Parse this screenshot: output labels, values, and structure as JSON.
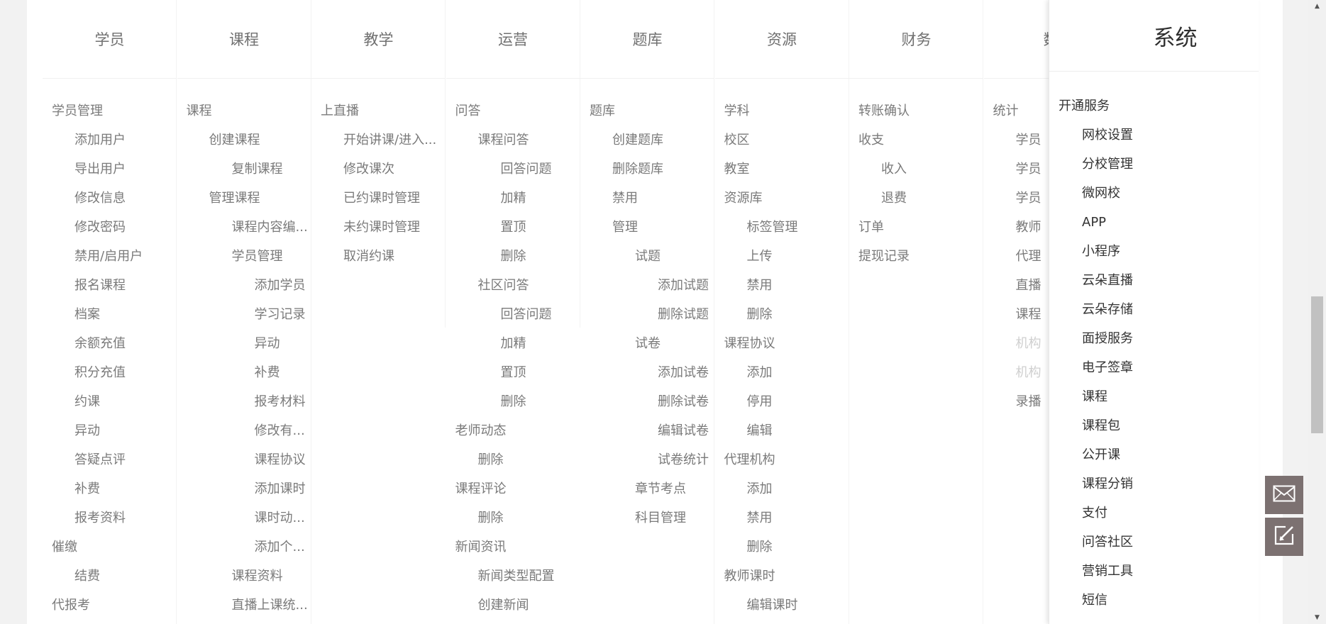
{
  "columns": [
    {
      "title": "学员",
      "items": [
        {
          "text": "学员管理",
          "level": 0,
          "faded": false
        },
        {
          "text": "添加用户",
          "level": 1,
          "faded": false
        },
        {
          "text": "导出用户",
          "level": 1,
          "faded": false
        },
        {
          "text": "修改信息",
          "level": 1,
          "faded": false
        },
        {
          "text": "修改密码",
          "level": 1,
          "faded": false
        },
        {
          "text": "禁用/启用户",
          "level": 1,
          "faded": false
        },
        {
          "text": "报名课程",
          "level": 1,
          "faded": false
        },
        {
          "text": "档案",
          "level": 1,
          "faded": false
        },
        {
          "text": "余额充值",
          "level": 1,
          "faded": false
        },
        {
          "text": "积分充值",
          "level": 1,
          "faded": false
        },
        {
          "text": "约课",
          "level": 1,
          "faded": false
        },
        {
          "text": "异动",
          "level": 1,
          "faded": false
        },
        {
          "text": "答疑点评",
          "level": 1,
          "faded": false
        },
        {
          "text": "补费",
          "level": 1,
          "faded": false
        },
        {
          "text": "报考资料",
          "level": 1,
          "faded": false
        },
        {
          "text": "催缴",
          "level": 0,
          "faded": false
        },
        {
          "text": "结费",
          "level": 1,
          "faded": false
        },
        {
          "text": "代报考",
          "level": 0,
          "faded": false
        }
      ]
    },
    {
      "title": "课程",
      "items": [
        {
          "text": "课程",
          "level": 0,
          "faded": false
        },
        {
          "text": "创建课程",
          "level": 1,
          "faded": false
        },
        {
          "text": "复制课程",
          "level": 2,
          "faded": false
        },
        {
          "text": "管理课程",
          "level": 1,
          "faded": false
        },
        {
          "text": "课程内容编...",
          "level": 2,
          "faded": false
        },
        {
          "text": "学员管理",
          "level": 2,
          "faded": false
        },
        {
          "text": "添加学员",
          "level": 3,
          "faded": false
        },
        {
          "text": "学习记录",
          "level": 3,
          "faded": false
        },
        {
          "text": "异动",
          "level": 3,
          "faded": false
        },
        {
          "text": "补费",
          "level": 3,
          "faded": false
        },
        {
          "text": "报考材料",
          "level": 3,
          "faded": false
        },
        {
          "text": "修改有...",
          "level": 3,
          "faded": false
        },
        {
          "text": "课程协议",
          "level": 3,
          "faded": false
        },
        {
          "text": "添加课时",
          "level": 3,
          "faded": false
        },
        {
          "text": "课时动...",
          "level": 3,
          "faded": false
        },
        {
          "text": "添加个...",
          "level": 3,
          "faded": false
        },
        {
          "text": "课程资料",
          "level": 2,
          "faded": false
        },
        {
          "text": "直播上课统...",
          "level": 2,
          "faded": false
        }
      ]
    },
    {
      "title": "教学",
      "items": [
        {
          "text": "上直播",
          "level": 0,
          "faded": false
        },
        {
          "text": "开始讲课/进入...",
          "level": 1,
          "faded": false
        },
        {
          "text": "修改课次",
          "level": 1,
          "faded": false
        },
        {
          "text": "已约课时管理",
          "level": 1,
          "faded": false
        },
        {
          "text": "未约课时管理",
          "level": 1,
          "faded": false
        },
        {
          "text": "取消约课",
          "level": 1,
          "faded": false
        }
      ]
    },
    {
      "title": "运营",
      "items": [
        {
          "text": "问答",
          "level": 0,
          "faded": false
        },
        {
          "text": "课程问答",
          "level": 1,
          "faded": false
        },
        {
          "text": "回答问题",
          "level": 2,
          "faded": false
        },
        {
          "text": "加精",
          "level": 2,
          "faded": false
        },
        {
          "text": "置顶",
          "level": 2,
          "faded": false
        },
        {
          "text": "删除",
          "level": 2,
          "faded": false
        },
        {
          "text": "社区问答",
          "level": 1,
          "faded": false
        },
        {
          "text": "回答问题",
          "level": 2,
          "faded": false
        },
        {
          "text": "加精",
          "level": 2,
          "faded": false
        },
        {
          "text": "置顶",
          "level": 2,
          "faded": false
        },
        {
          "text": "删除",
          "level": 2,
          "faded": false
        },
        {
          "text": "老师动态",
          "level": 0,
          "faded": false
        },
        {
          "text": "删除",
          "level": 1,
          "faded": false
        },
        {
          "text": "课程评论",
          "level": 0,
          "faded": false
        },
        {
          "text": "删除",
          "level": 1,
          "faded": false
        },
        {
          "text": "新闻资讯",
          "level": 0,
          "faded": false
        },
        {
          "text": "新闻类型配置",
          "level": 1,
          "faded": false
        },
        {
          "text": "创建新闻",
          "level": 1,
          "faded": false
        }
      ]
    },
    {
      "title": "题库",
      "items": [
        {
          "text": "题库",
          "level": 0,
          "faded": false
        },
        {
          "text": "创建题库",
          "level": 1,
          "faded": false
        },
        {
          "text": "删除题库",
          "level": 1,
          "faded": false
        },
        {
          "text": "禁用",
          "level": 1,
          "faded": false
        },
        {
          "text": "管理",
          "level": 1,
          "faded": false
        },
        {
          "text": "试题",
          "level": 2,
          "faded": false
        },
        {
          "text": "添加试题",
          "level": 3,
          "faded": false
        },
        {
          "text": "删除试题",
          "level": 3,
          "faded": false
        },
        {
          "text": "试卷",
          "level": 2,
          "faded": false
        },
        {
          "text": "添加试卷",
          "level": 3,
          "faded": false
        },
        {
          "text": "删除试卷",
          "level": 3,
          "faded": false
        },
        {
          "text": "编辑试卷",
          "level": 3,
          "faded": false
        },
        {
          "text": "试卷统计",
          "level": 3,
          "faded": false
        },
        {
          "text": "章节考点",
          "level": 2,
          "faded": false
        },
        {
          "text": "科目管理",
          "level": 2,
          "faded": false
        }
      ]
    },
    {
      "title": "资源",
      "items": [
        {
          "text": "学科",
          "level": 0,
          "faded": false
        },
        {
          "text": "校区",
          "level": 0,
          "faded": false
        },
        {
          "text": "教室",
          "level": 0,
          "faded": false
        },
        {
          "text": "资源库",
          "level": 0,
          "faded": false
        },
        {
          "text": "标签管理",
          "level": 1,
          "faded": false
        },
        {
          "text": "上传",
          "level": 1,
          "faded": false
        },
        {
          "text": "禁用",
          "level": 1,
          "faded": false
        },
        {
          "text": "删除",
          "level": 1,
          "faded": false
        },
        {
          "text": "课程协议",
          "level": 0,
          "faded": false
        },
        {
          "text": "添加",
          "level": 1,
          "faded": false
        },
        {
          "text": "停用",
          "level": 1,
          "faded": false
        },
        {
          "text": "编辑",
          "level": 1,
          "faded": false
        },
        {
          "text": "代理机构",
          "level": 0,
          "faded": false
        },
        {
          "text": "添加",
          "level": 1,
          "faded": false
        },
        {
          "text": "禁用",
          "level": 1,
          "faded": false
        },
        {
          "text": "删除",
          "level": 1,
          "faded": false
        },
        {
          "text": "教师课时",
          "level": 0,
          "faded": false
        },
        {
          "text": "编辑课时",
          "level": 1,
          "faded": false
        }
      ]
    },
    {
      "title": "财务",
      "items": [
        {
          "text": "转账确认",
          "level": 0,
          "faded": false
        },
        {
          "text": "收支",
          "level": 0,
          "faded": false
        },
        {
          "text": "收入",
          "level": 1,
          "faded": false
        },
        {
          "text": "退费",
          "level": 1,
          "faded": false
        },
        {
          "text": "订单",
          "level": 0,
          "faded": false
        },
        {
          "text": "提现记录",
          "level": 0,
          "faded": false
        }
      ]
    },
    {
      "title": "数",
      "items": [
        {
          "text": "统计",
          "level": 0,
          "faded": false
        },
        {
          "text": "学员",
          "level": 1,
          "faded": false
        },
        {
          "text": "学员",
          "level": 1,
          "faded": false
        },
        {
          "text": "学员",
          "level": 1,
          "faded": false
        },
        {
          "text": "教师",
          "level": 1,
          "faded": false
        },
        {
          "text": "代理",
          "level": 1,
          "faded": false
        },
        {
          "text": "直播",
          "level": 1,
          "faded": false
        },
        {
          "text": "课程",
          "level": 1,
          "faded": false
        },
        {
          "text": "机构",
          "level": 1,
          "faded": true
        },
        {
          "text": "机构",
          "level": 1,
          "faded": true
        },
        {
          "text": "录播",
          "level": 1,
          "faded": false
        }
      ]
    }
  ],
  "system": {
    "title": "系统",
    "items": [
      {
        "text": "开通服务",
        "level": 0
      },
      {
        "text": "网校设置",
        "level": 1
      },
      {
        "text": "分校管理",
        "level": 1
      },
      {
        "text": "微网校",
        "level": 1
      },
      {
        "text": "APP",
        "level": 1
      },
      {
        "text": "小程序",
        "level": 1
      },
      {
        "text": "云朵直播",
        "level": 1
      },
      {
        "text": "云朵存储",
        "level": 1
      },
      {
        "text": "面授服务",
        "level": 1
      },
      {
        "text": "电子签章",
        "level": 1
      },
      {
        "text": "课程",
        "level": 1
      },
      {
        "text": "课程包",
        "level": 1
      },
      {
        "text": "公开课",
        "level": 1
      },
      {
        "text": "课程分销",
        "level": 1
      },
      {
        "text": "支付",
        "level": 1
      },
      {
        "text": "问答社区",
        "level": 1
      },
      {
        "text": "营销工具",
        "level": 1
      },
      {
        "text": "短信",
        "level": 1
      }
    ]
  },
  "colors": {
    "float_button_bg": "#7c7171",
    "panel_bg": "#ffffff",
    "page_bg": "#f2f2f2"
  },
  "icons": {
    "mail": "mail-icon",
    "edit": "edit-icon"
  }
}
